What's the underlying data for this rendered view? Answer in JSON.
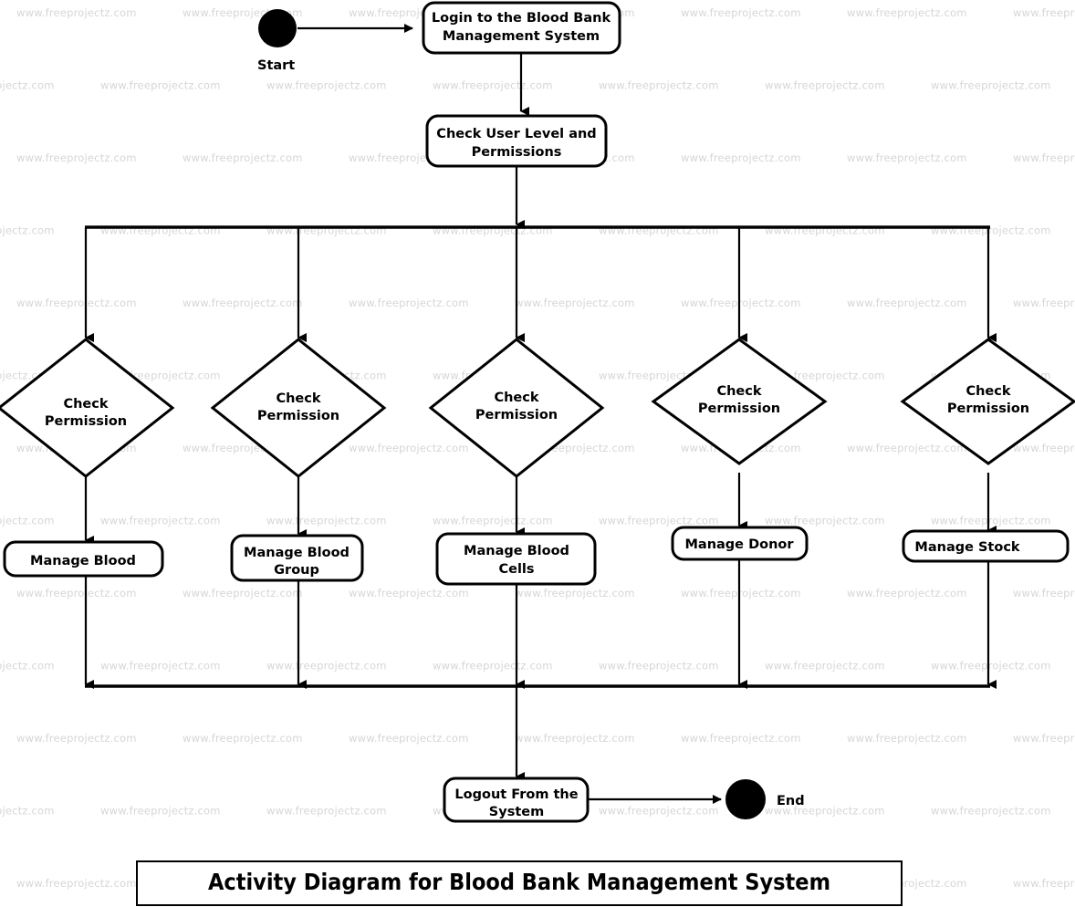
{
  "diagram": {
    "title": "Activity Diagram for Blood Bank Management System",
    "watermark": "www.freeprojectz.com",
    "colors": {
      "stroke": "#000000",
      "fill": "#ffffff",
      "watermark": "#d6d6d6",
      "background": "#ffffff"
    },
    "terminals": {
      "start_label": "Start",
      "end_label": "End"
    },
    "activities": {
      "login": "Login to the Blood Bank Management System",
      "login_line1": "Login to the Blood Bank",
      "login_line2": "Management System",
      "check_user": "Check User Level and Permissions",
      "check_user_line1": "Check User Level and",
      "check_user_line2": "Permissions",
      "logout": "Logout From the System",
      "logout_line1": "Logout From the",
      "logout_line2": "System"
    },
    "decisions": [
      {
        "id": "d1",
        "line1": "Check",
        "line2": "Permission"
      },
      {
        "id": "d2",
        "line1": "Check",
        "line2": "Permission"
      },
      {
        "id": "d3",
        "line1": "Check",
        "line2": "Permission"
      },
      {
        "id": "d4",
        "line1": "Check",
        "line2": "Permission"
      },
      {
        "id": "d5",
        "line1": "Check",
        "line2": "Permission"
      }
    ],
    "manage_nodes": [
      {
        "id": "m1",
        "label": "Manage Blood",
        "line1": "Manage Blood",
        "line2": ""
      },
      {
        "id": "m2",
        "label": "Manage Blood Group",
        "line1": "Manage Blood",
        "line2": "Group"
      },
      {
        "id": "m3",
        "label": "Manage Blood Cells",
        "line1": "Manage Blood",
        "line2": "Cells"
      },
      {
        "id": "m4",
        "label": "Manage Donor",
        "line1": "Manage Donor",
        "line2": ""
      },
      {
        "id": "m5",
        "label": "Manage Stock",
        "line1": "Manage Stock",
        "line2": ""
      }
    ]
  }
}
